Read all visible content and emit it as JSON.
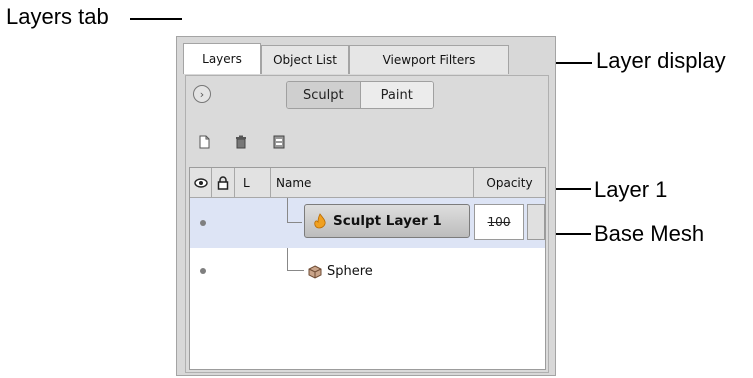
{
  "callouts": {
    "layers_tab": "Layers tab",
    "layer_display": "Layer display",
    "layer1": "Layer 1",
    "base_mesh": "Base Mesh"
  },
  "tabs": [
    {
      "label": "Layers",
      "active": true
    },
    {
      "label": "Object List",
      "active": false
    },
    {
      "label": "Viewport Filters",
      "active": false
    }
  ],
  "display_toggle": {
    "sculpt": "Sculpt",
    "paint": "Paint",
    "selected": "Sculpt"
  },
  "toolbar_icons": [
    "new-layer-icon",
    "delete-layer-icon",
    "merge-layer-icon"
  ],
  "table": {
    "columns": {
      "visible": "eye-icon",
      "lock": "lock-icon",
      "l": "L",
      "name": "Name",
      "opacity": "Opacity"
    },
    "rows": [
      {
        "name": "Sculpt Layer 1",
        "opacity": "100",
        "icon": "sculpt-layer-icon",
        "selected": true
      },
      {
        "name": "Sphere",
        "icon": "mesh-icon",
        "selected": false
      }
    ]
  },
  "colors": {
    "selected_row": "#dde4f5",
    "panel": "#d8d8d8"
  }
}
